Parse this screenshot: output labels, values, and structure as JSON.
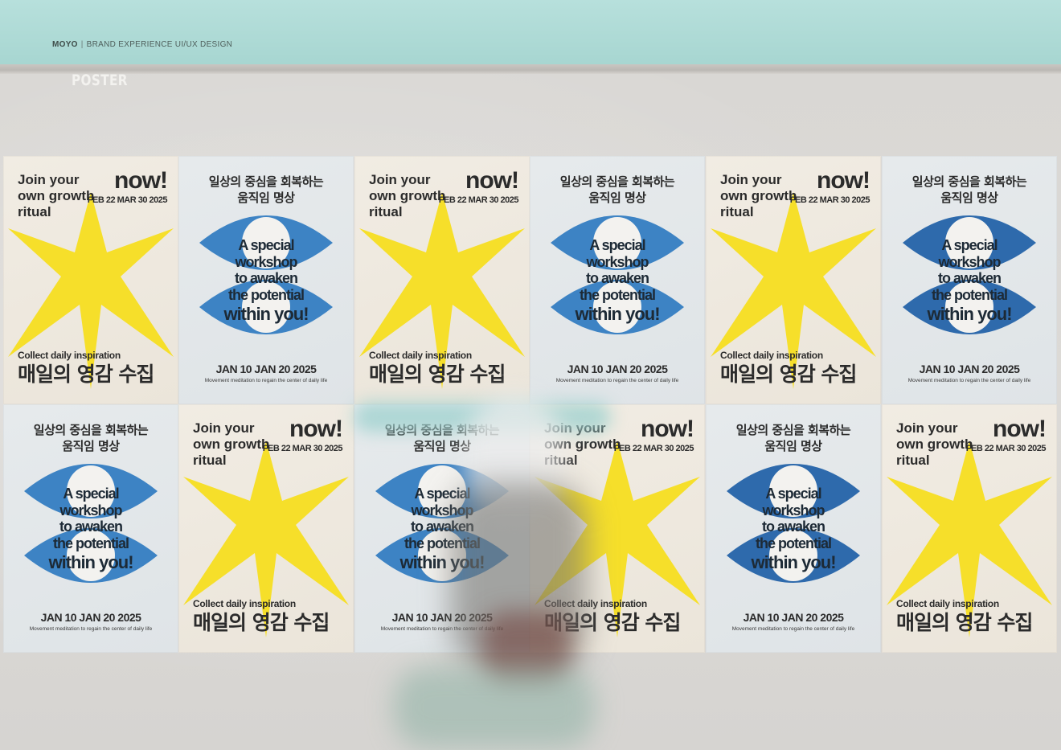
{
  "header": {
    "brand": "MOYO",
    "subtitle": "BRAND EXPERIENCE UI/UX DESIGN",
    "section": "POSTER"
  },
  "poster_star": {
    "join": "Join your own growth ritual",
    "now": "now!",
    "dates": "FEB 22 MAR 30 2025",
    "collect": "Collect daily inspiration",
    "korean": "매일의 영감 수집"
  },
  "poster_eye": {
    "korean_line1": "일상의 중심을 회복하는",
    "korean_line2": "움직임 명상",
    "line1": "A special",
    "line2": "workshop",
    "line3": "to awaken",
    "line4": "the potential",
    "line5": "within you!",
    "dates": "JAN 10 JAN 20 2025",
    "caption": "Movement meditation to regain the center of daily life"
  },
  "colors": {
    "yellow": "#f6df2a",
    "blue": "#3d83c4",
    "blue_dark": "#2e6aac",
    "sky": "#aad8d3",
    "wall": "#dbd9d6"
  },
  "grid": {
    "rows": [
      [
        "star",
        "eye",
        "star",
        "eye",
        "star",
        "eye"
      ],
      [
        "eye",
        "star",
        "eye",
        "star",
        "eye",
        "star"
      ]
    ]
  }
}
